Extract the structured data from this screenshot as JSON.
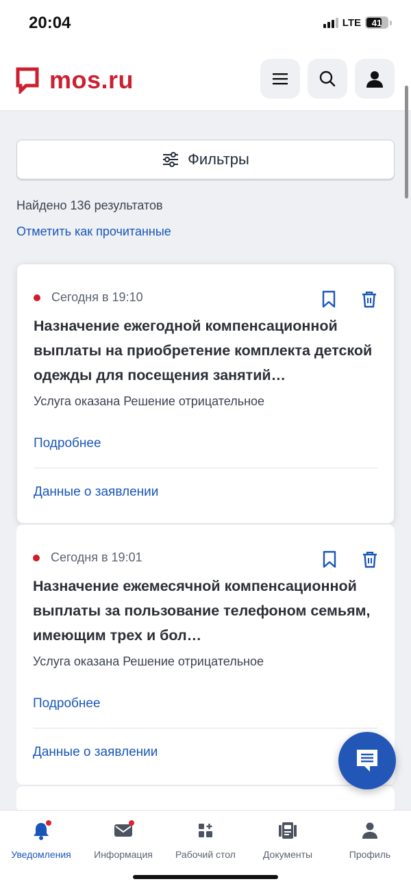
{
  "status_bar": {
    "time": "20:04",
    "network": "LTE",
    "battery": "41"
  },
  "header": {
    "logo_text": "mos.ru"
  },
  "filters": {
    "label": "Фильтры"
  },
  "results": {
    "found": "Найдено 136 результатов",
    "mark_read": "Отметить как прочитанные"
  },
  "cards": [
    {
      "time": "Сегодня в 19:10",
      "title": "Назначение ежегодной компенсационной выплаты на приобретение комплекта детской одежды для посещения занятий…",
      "status": "Услуга оказана Решение отрицательное",
      "more": "Подробнее",
      "application": "Данные о заявлении"
    },
    {
      "time": "Сегодня в 19:01",
      "title": "Назначение ежемесячной компенсационной выплаты за пользование телефоном семьям, имеющим трех и бол…",
      "status": "Услуга оказана Решение отрицательное",
      "more": "Подробнее",
      "application": "Данные о заявлении"
    }
  ],
  "bottom_nav": [
    {
      "label": "Уведомления",
      "icon": "bell-icon",
      "active": true
    },
    {
      "label": "Информация",
      "icon": "mail-icon",
      "active": false
    },
    {
      "label": "Рабочий стол",
      "icon": "dashboard-icon",
      "active": false
    },
    {
      "label": "Документы",
      "icon": "documents-icon",
      "active": false
    },
    {
      "label": "Профиль",
      "icon": "profile-icon",
      "active": false
    }
  ],
  "colors": {
    "brand_red": "#cc1f2f",
    "link_blue": "#1956b9",
    "accent_blue": "#2257b8",
    "unread_dot": "#d21c2c"
  }
}
